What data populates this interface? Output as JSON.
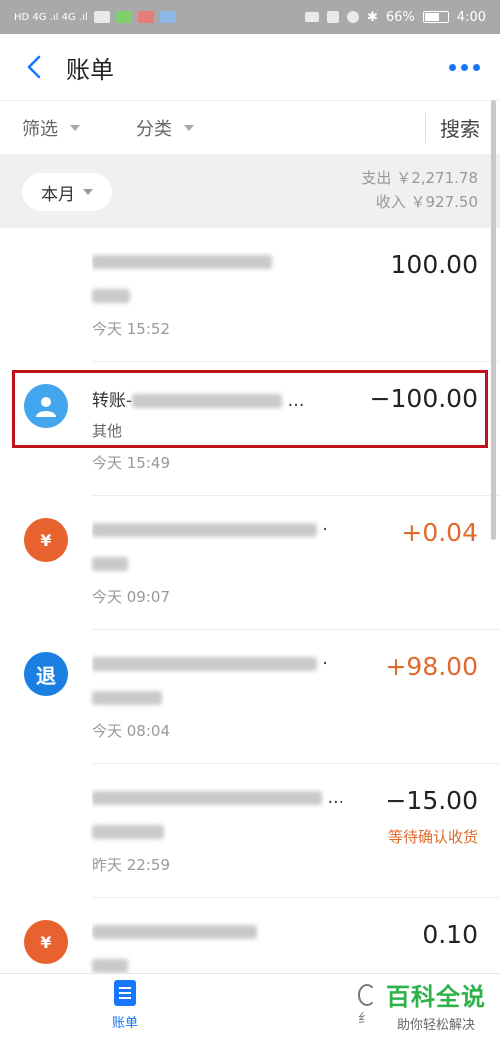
{
  "status_bar": {
    "left": "HD 4G .ıl 4G .ıl",
    "battery": "66%",
    "time": "4:00"
  },
  "header": {
    "title": "账单"
  },
  "filters": {
    "screen": "筛选",
    "category": "分类",
    "search": "搜索"
  },
  "summary": {
    "month": "本月",
    "expense": "支出 ￥2,271.78",
    "income": "收入 ￥927.50"
  },
  "transactions": [
    {
      "title": "",
      "sub": "",
      "time": "今天 15:52",
      "amount": "100.00"
    },
    {
      "title": "转账-",
      "sub": "其他",
      "time": "今天 15:49",
      "amount": "−100.00"
    },
    {
      "title": "",
      "sub": "",
      "time": "今天 09:07",
      "amount": "+0.04",
      "icon": "¥"
    },
    {
      "title": "",
      "sub": "",
      "time": "今天 08:04",
      "amount": "+98.00",
      "icon": "退"
    },
    {
      "title": "",
      "sub": "",
      "time": "昨天 22:59",
      "amount": "−15.00",
      "status": "等待确认收货"
    },
    {
      "title": "",
      "sub": "",
      "time": "",
      "amount": "0.10",
      "icon": "¥"
    }
  ],
  "tab_bar": {
    "bill_label": "账单",
    "other_partial": "纟"
  },
  "watermark": {
    "main": "百科全说",
    "sub": "助你轻松解决"
  },
  "colors": {
    "accent": "#1677ff",
    "income": "#e06a2c",
    "highlight": "#c0121b",
    "orange_icon": "#e8622f"
  }
}
